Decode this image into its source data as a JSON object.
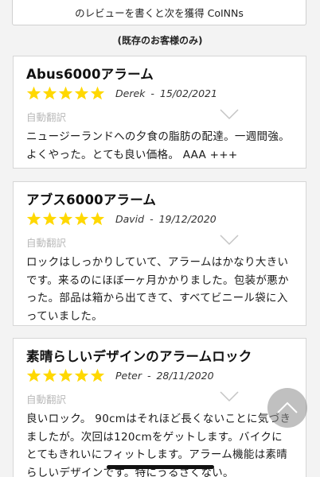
{
  "review_cta": {
    "label": "のレビューを書くと次を獲得 CoINNs"
  },
  "existing_note": "(既存のお客様のみ)",
  "colors": {
    "star": "#ffd800",
    "muted_text": "#b9b9b9"
  },
  "reviews": [
    {
      "title": "Abus6000アラーム",
      "rating": 5,
      "reviewer": "Derek",
      "separator": "-",
      "date": "15/02/2021",
      "translate_label": "自動翻訳",
      "body": "ニュージーランドへの夕食の脂肪の配達。一週間強。よくやった。とても良い価格。 AAA +++"
    },
    {
      "title": "アブス6000アラーム",
      "rating": 5,
      "reviewer": "David",
      "separator": "-",
      "date": "19/12/2020",
      "translate_label": "自動翻訳",
      "body": "ロックはしっかりしていて、アラームはかなり大きいです。来るのにほぼ一ヶ月かかりました。包装が悪かった。部品は箱から出てきて、すべてビニール袋に入っていました。"
    },
    {
      "title": "素晴らしいデザインのアラームロック",
      "rating": 5,
      "reviewer": "Peter",
      "separator": "-",
      "date": "28/11/2020",
      "translate_label": "自動翻訳",
      "body": "良いロック。 90cmはそれほど長くないことに気づきましたが。次回は120cmをゲットします。バイクにとてもきれいにフィットします。アラーム機能は素晴らしいデザインです。特にうるさくない。"
    }
  ],
  "icons": {
    "star": "star-icon",
    "chevron": "chevron-down-icon",
    "scroll_top": "chevron-up-icon"
  }
}
